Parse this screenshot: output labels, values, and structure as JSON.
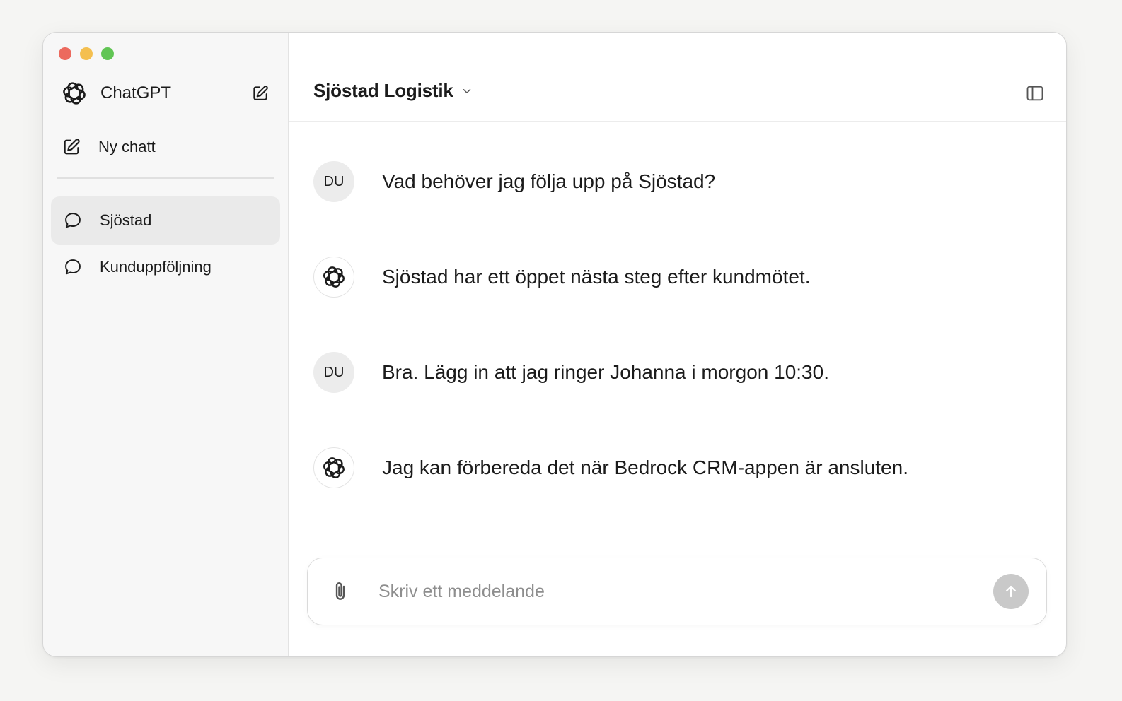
{
  "window": {
    "controls": [
      "close",
      "minimize",
      "maximize"
    ]
  },
  "sidebar": {
    "brand": {
      "name": "ChatGPT",
      "logo_icon": "openai-logo-icon",
      "edit_icon": "compose-icon"
    },
    "new_chat": {
      "label": "Ny chatt",
      "icon": "compose-icon"
    },
    "chats": [
      {
        "label": "Sjöstad",
        "icon": "chat-bubble-icon",
        "active": true
      },
      {
        "label": "Kunduppföljning",
        "icon": "chat-bubble-icon",
        "active": false
      }
    ]
  },
  "header": {
    "project_title": "Sjöstad Logistik",
    "dropdown_icon": "chevron-down-icon",
    "toggle_icon": "sidebar-toggle-icon"
  },
  "messages": [
    {
      "role": "user",
      "avatar": "DU",
      "text": "Vad behöver jag följa upp på Sjöstad?"
    },
    {
      "role": "assistant",
      "avatar_icon": "openai-logo-icon",
      "text": "Sjöstad har ett öppet nästa steg efter kundmötet."
    },
    {
      "role": "user",
      "avatar": "DU",
      "text": "Bra. Lägg in att jag ringer Johanna i morgon 10:30."
    },
    {
      "role": "assistant",
      "avatar_icon": "openai-logo-icon",
      "text": "Jag kan förbereda det när Bedrock CRM-appen är ansluten."
    }
  ],
  "composer": {
    "placeholder": "Skriv ett meddelande",
    "value": "",
    "attach_icon": "paperclip-icon",
    "send_icon": "arrow-up-icon"
  },
  "colors": {
    "close": "#ec6a5e",
    "minimize": "#f4bf4f",
    "maximize": "#61c554",
    "sidebar_bg": "#f7f7f7",
    "active_chat_bg": "#eaeaea",
    "send_button_disabled": "#c9c9c9"
  }
}
